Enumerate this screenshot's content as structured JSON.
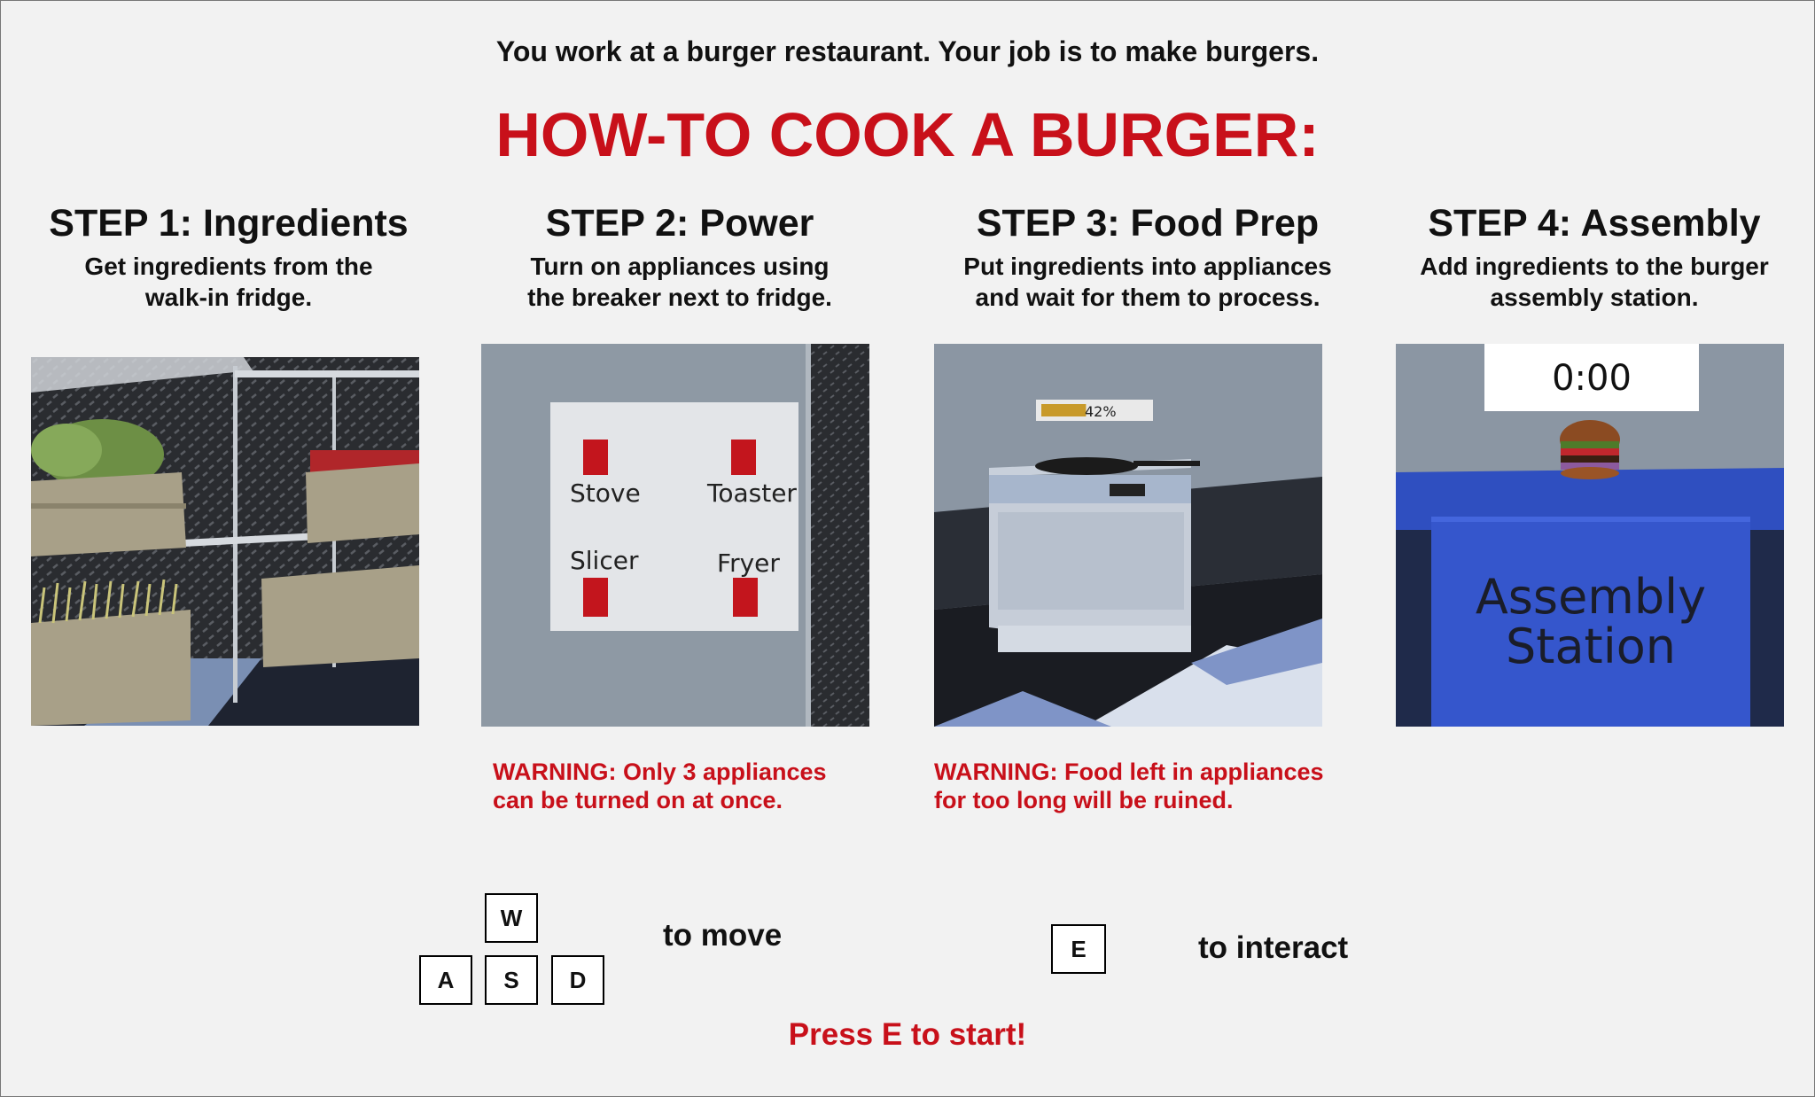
{
  "intro": "You work at a burger restaurant. Your job is to make burgers.",
  "title": "HOW-TO COOK A BURGER:",
  "steps": [
    {
      "title": "STEP 1: Ingredients",
      "line1": "Get ingredients from the",
      "line2": "walk-in fridge."
    },
    {
      "title": "STEP 2: Power",
      "line1": "Turn on appliances using",
      "line2": "the breaker next to fridge."
    },
    {
      "title": "STEP 3: Food Prep",
      "line1": "Put ingredients into appliances",
      "line2": "and wait for them to process."
    },
    {
      "title": "STEP 4: Assembly",
      "line1": "Add ingredients to the burger",
      "line2": "assembly station."
    }
  ],
  "breaker": {
    "stove": "Stove",
    "toaster": "Toaster",
    "slicer": "Slicer",
    "fryer": "Fryer"
  },
  "progress": {
    "label": "42%",
    "value": 0.42
  },
  "timer": "0:00",
  "station_label": {
    "line1": "Assembly",
    "line2": "Station"
  },
  "warnings": [
    {
      "line1": "WARNING: Only 3 appliances",
      "line2": "can be turned on at once."
    },
    {
      "line1": "WARNING: Food left in appliances",
      "line2": "for too long will be ruined."
    }
  ],
  "keys": {
    "w": "W",
    "a": "A",
    "s": "S",
    "d": "D",
    "e": "E"
  },
  "hints": {
    "move": "to move",
    "interact": "to interact"
  },
  "start": "Press E to start!",
  "colors": {
    "accent_red": "#c8101a",
    "station_blue": "#2f4fc0"
  }
}
